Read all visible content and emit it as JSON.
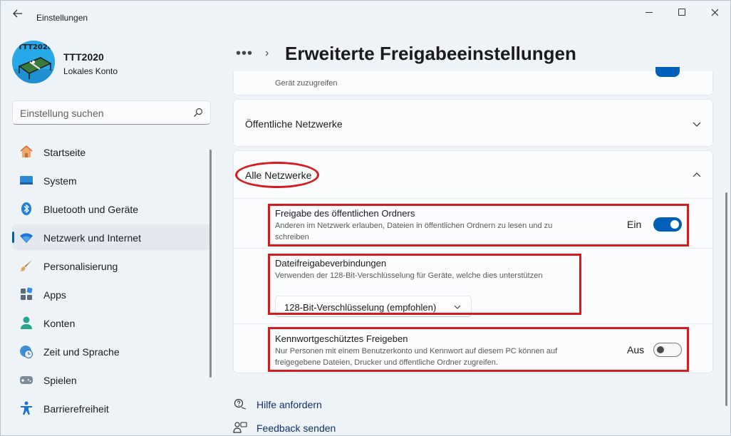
{
  "window": {
    "app_title": "Einstellungen"
  },
  "user": {
    "avatar_text": "TTT2020",
    "name": "TTT2020",
    "account_type": "Lokales Konto"
  },
  "search": {
    "placeholder": "Einstellung suchen"
  },
  "sidebar": {
    "items": [
      {
        "label": "Startseite",
        "icon": "home-icon"
      },
      {
        "label": "System",
        "icon": "system-icon"
      },
      {
        "label": "Bluetooth und Geräte",
        "icon": "bluetooth-icon"
      },
      {
        "label": "Netzwerk und Internet",
        "icon": "wifi-icon",
        "active": true
      },
      {
        "label": "Personalisierung",
        "icon": "brush-icon"
      },
      {
        "label": "Apps",
        "icon": "apps-icon"
      },
      {
        "label": "Konten",
        "icon": "account-icon"
      },
      {
        "label": "Zeit und Sprache",
        "icon": "clock-globe-icon"
      },
      {
        "label": "Spielen",
        "icon": "gamepad-icon"
      },
      {
        "label": "Barrierefreiheit",
        "icon": "accessibility-icon"
      }
    ]
  },
  "header": {
    "breadcrumb_more": "•••",
    "breadcrumb_sep": "›",
    "title": "Erweiterte Freigabeeinstellungen"
  },
  "content": {
    "prev_card_desc": "Gerät zuzugreifen",
    "public_networks": {
      "title": "Öffentliche Netzwerke",
      "expanded": false
    },
    "all_networks": {
      "title": "Alle Netzwerke",
      "expanded": true,
      "rows": {
        "public_folder": {
          "title": "Freigabe des öffentlichen Ordners",
          "desc_line1": "Anderen im Netzwerk erlauben, Dateien in öffentlichen Ordnern zu lesen und zu",
          "desc_line2": "schreiben",
          "state_label": "Ein",
          "state": true
        },
        "file_sharing": {
          "title": "Dateifreigabeverbindungen",
          "desc": "Verwenden der 128-Bit-Verschlüsselung für Geräte, welche dies unterstützen",
          "dropdown_value": "128-Bit-Verschlüsselung (empfohlen)"
        },
        "password_sharing": {
          "title": "Kennwortgeschütztes Freigeben",
          "desc_line1": "Nur Personen mit einem Benutzerkonto und Kennwort auf diesem PC können auf",
          "desc_line2": "freigegebene Dateien, Drucker und öffentliche Ordner zugreifen.",
          "state_label": "Aus",
          "state": false
        }
      }
    }
  },
  "footer": {
    "help": "Hilfe anfordern",
    "feedback": "Feedback senden"
  },
  "colors": {
    "accent": "#005fb8",
    "annotation": "#d71920",
    "background": "#eef3f8"
  }
}
